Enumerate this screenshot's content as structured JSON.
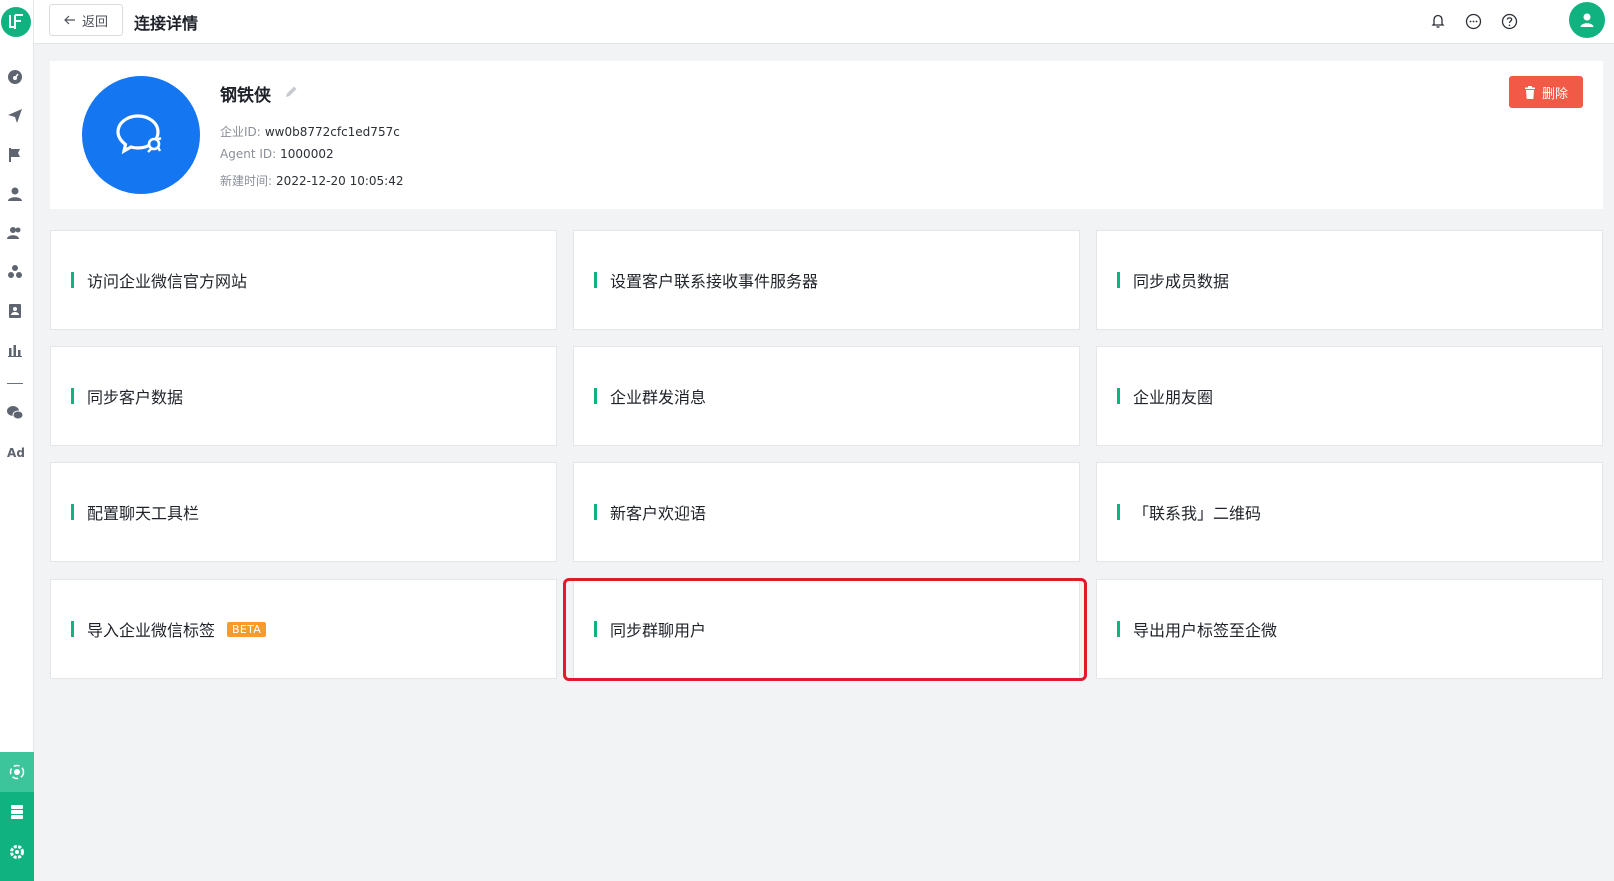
{
  "sidebar": {
    "logo_text": "LF",
    "ad_label": "Ad"
  },
  "header": {
    "back_label": "返回",
    "title": "连接详情"
  },
  "profile": {
    "name": "钢铁侠",
    "corp_id_label": "企业ID:",
    "corp_id": "ww0b8772cfc1ed757c",
    "agent_id_label": "Agent ID:",
    "agent_id": "1000002",
    "created_label": "新建时间:",
    "created": "2022-12-20 10:05:42",
    "delete_label": "删除"
  },
  "cards": [
    {
      "label": "访问企业微信官方网站"
    },
    {
      "label": "设置客户联系接收事件服务器"
    },
    {
      "label": "同步成员数据"
    },
    {
      "label": "同步客户数据"
    },
    {
      "label": "企业群发消息"
    },
    {
      "label": "企业朋友圈"
    },
    {
      "label": "配置聊天工具栏"
    },
    {
      "label": "新客户欢迎语"
    },
    {
      "label": "「联系我」二维码"
    },
    {
      "label": "导入企业微信标签",
      "badge": "BETA"
    },
    {
      "label": "同步群聊用户"
    },
    {
      "label": "导出用户标签至企微"
    }
  ],
  "colors": {
    "brand_green": "#10b27f",
    "wechat_blue": "#1476f0",
    "danger": "#f25a47",
    "beta_orange": "#f79b2e",
    "highlight_red": "#e0192b"
  }
}
